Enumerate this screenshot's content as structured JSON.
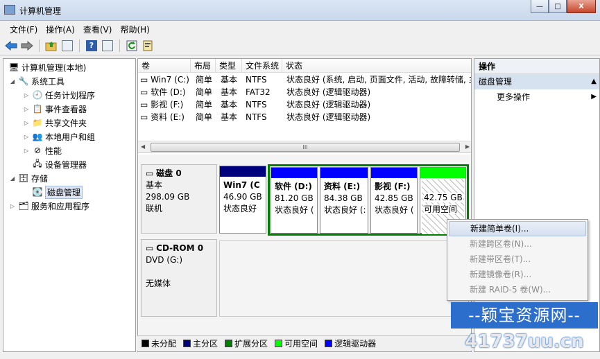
{
  "window": {
    "title": "计算机管理",
    "buttons": {
      "minimize": "—",
      "maximize": "□",
      "close": "X"
    }
  },
  "menu": [
    "文件(F)",
    "操作(A)",
    "查看(V)",
    "帮助(H)"
  ],
  "tree": {
    "root": "计算机管理(本地)",
    "system_tools": "系统工具",
    "task_scheduler": "任务计划程序",
    "event_viewer": "事件查看器",
    "shared_folders": "共享文件夹",
    "local_users": "本地用户和组",
    "performance": "性能",
    "device_manager": "设备管理器",
    "storage": "存储",
    "disk_management": "磁盘管理",
    "services": "服务和应用程序"
  },
  "volume_table": {
    "headers": [
      "卷",
      "布局",
      "类型",
      "文件系统",
      "状态"
    ],
    "rows": [
      [
        "Win7 (C:)",
        "简单",
        "基本",
        "NTFS",
        "状态良好 (系统, 启动, 页面文件, 活动, 故障转储, 主"
      ],
      [
        "软件 (D:)",
        "简单",
        "基本",
        "FAT32",
        "状态良好 (逻辑驱动器)"
      ],
      [
        "影视 (F:)",
        "简单",
        "基本",
        "NTFS",
        "状态良好 (逻辑驱动器)"
      ],
      [
        "资料 (E:)",
        "简单",
        "基本",
        "NTFS",
        "状态良好 (逻辑驱动器)"
      ]
    ],
    "scroll_grip": "III"
  },
  "disk0": {
    "name": "磁盘 0",
    "type": "基本",
    "size": "298.09 GB",
    "state": "联机",
    "partitions": [
      {
        "name": "Win7 (C",
        "size": "46.90 GB",
        "status": "状态良好",
        "color": "#00007f"
      },
      {
        "name": "软件 (D:)",
        "size": "81.20 GB",
        "status": "状态良好 (",
        "color": "#0000ff"
      },
      {
        "name": "资料 (E:)",
        "size": "84.38 GB",
        "status": "状态良好 (:",
        "color": "#0000ff"
      },
      {
        "name": "影视 (F:)",
        "size": "42.85 GB",
        "status": "状态良好 (",
        "color": "#0000ff"
      },
      {
        "name": "",
        "size": "42.75 GB",
        "status": "可用空间",
        "color": "#00ff00"
      }
    ]
  },
  "cdrom0": {
    "name": "CD-ROM 0",
    "drive": "DVD (G:)",
    "media": "无媒体"
  },
  "legend": [
    {
      "label": "未分配",
      "color": "#000000"
    },
    {
      "label": "主分区",
      "color": "#00007f"
    },
    {
      "label": "扩展分区",
      "color": "#007f00"
    },
    {
      "label": "可用空间",
      "color": "#00ff00"
    },
    {
      "label": "逻辑驱动器",
      "color": "#0000ff"
    }
  ],
  "actions": {
    "header": "操作",
    "section": "磁盘管理",
    "more": "更多操作"
  },
  "context_menu": [
    {
      "label": "新建简单卷(I)...",
      "enabled": true
    },
    {
      "label": "新建跨区卷(N)...",
      "enabled": false
    },
    {
      "label": "新建带区卷(T)...",
      "enabled": false
    },
    {
      "label": "新建镜像卷(R)...",
      "enabled": false
    },
    {
      "label": "新建 RAID-5 卷(W)...",
      "enabled": false
    }
  ],
  "watermark": {
    "line1": "--颖宝资源网--",
    "line2": "41737uu.cn"
  }
}
